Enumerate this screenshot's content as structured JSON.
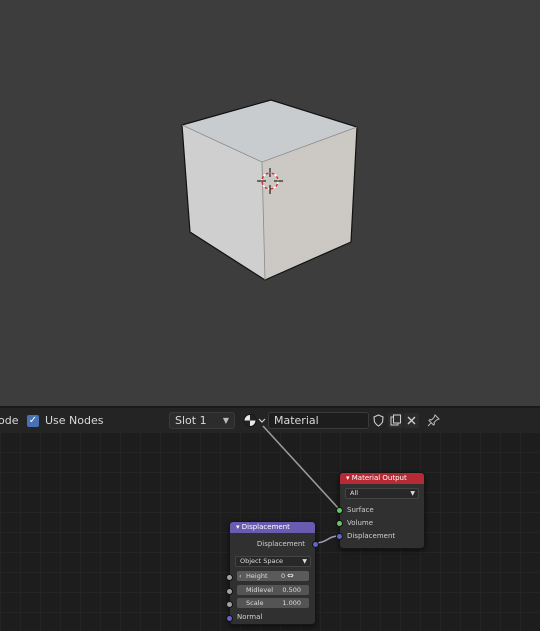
{
  "header": {
    "mode_partial": "ode",
    "use_nodes_label": "Use Nodes",
    "use_nodes_checked": true,
    "slot_label": "Slot 1",
    "material_name": "Material"
  },
  "nodes": {
    "material_output": {
      "title": "Material Output",
      "target": "All",
      "inputs": [
        "Surface",
        "Volume",
        "Displacement"
      ],
      "header_color": "#b52a34"
    },
    "displacement": {
      "title": "Displacement",
      "output": "Displacement",
      "space": "Object Space",
      "height_label": "Height",
      "height_value": "0",
      "midlevel_label": "Midlevel",
      "midlevel_value": "0.500",
      "scale_label": "Scale",
      "scale_value": "1.000",
      "normal_label": "Normal",
      "header_color": "#6b5bb0"
    }
  },
  "colors": {
    "accent": "#4772b3",
    "viewport_bg": "#3d3d3d",
    "editor_bg": "#1d1d1d"
  }
}
